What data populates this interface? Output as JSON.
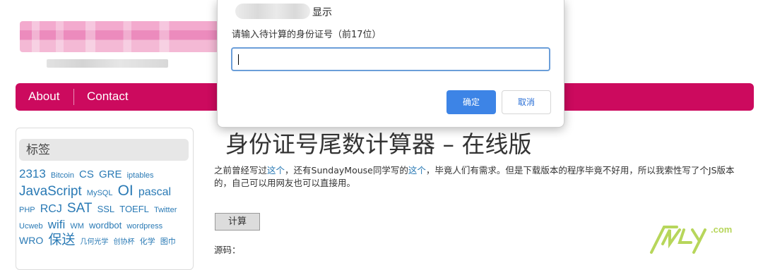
{
  "nav": {
    "items": [
      {
        "label": "About"
      },
      {
        "label": "Contact"
      }
    ]
  },
  "sidebar": {
    "title": "标签",
    "tags": [
      {
        "text": "2313",
        "size": 17
      },
      {
        "text": "Bitcoin",
        "size": 11
      },
      {
        "text": "CS",
        "size": 15
      },
      {
        "text": "GRE",
        "size": 15
      },
      {
        "text": "iptables",
        "size": 11
      },
      {
        "text": "JavaScript",
        "size": 19
      },
      {
        "text": "MySQL",
        "size": 11
      },
      {
        "text": "OI",
        "size": 21
      },
      {
        "text": "pascal",
        "size": 16
      },
      {
        "text": "PHP",
        "size": 11
      },
      {
        "text": "RCJ",
        "size": 16
      },
      {
        "text": "SAT",
        "size": 19
      },
      {
        "text": "SSL",
        "size": 13
      },
      {
        "text": "TOEFL",
        "size": 13
      },
      {
        "text": "Twitter",
        "size": 11
      },
      {
        "text": "Ucweb",
        "size": 11
      },
      {
        "text": "wifi",
        "size": 17
      },
      {
        "text": "WM",
        "size": 11
      },
      {
        "text": "wordbot",
        "size": 13
      },
      {
        "text": "wordpress",
        "size": 11
      },
      {
        "text": "WRO",
        "size": 14
      },
      {
        "text": "保送",
        "size": 19
      },
      {
        "text": "几何光学",
        "size": 10
      },
      {
        "text": "创协杯",
        "size": 10
      },
      {
        "text": "化学",
        "size": 11
      },
      {
        "text": "图巾",
        "size": 11
      }
    ]
  },
  "main": {
    "title": "身份证号尾数计算器 – 在线版",
    "intro": {
      "part1": "之前曾经写过",
      "link1": "这个",
      "part2": "，还有SundayMouse同学写的",
      "link2": "这个",
      "part3": "，毕竟人们有需求。但是下载版本的程序毕竟不好用，所以我索性写了个JS版本的，自己可以用网友也可以直接用。"
    },
    "calc_button": "计算",
    "source_label": "源码："
  },
  "dialog": {
    "shows_label": "显示",
    "message": "请输入待计算的身份证号（前17位）",
    "input_value": "",
    "ok_label": "确定",
    "cancel_label": "取消"
  },
  "watermark": {
    "suffix": ".com"
  },
  "colors": {
    "nav_bg": "#cc0a5e",
    "link": "#2a7ab5",
    "primary_button": "#3d84e6",
    "input_focus": "#6b9ed9"
  }
}
